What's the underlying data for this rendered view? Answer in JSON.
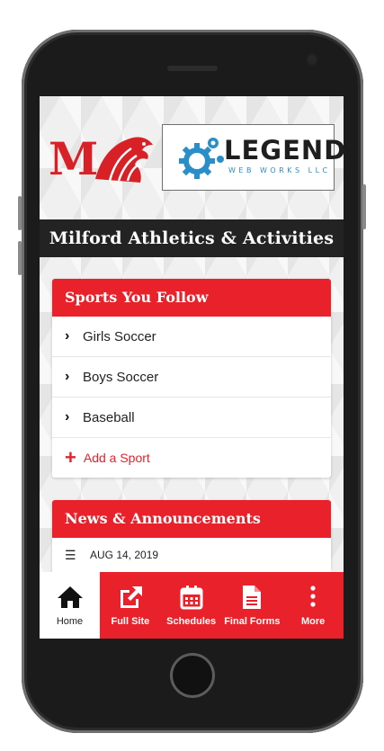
{
  "brand": {
    "school_logo_letter": "M",
    "sponsor_name": "LEGEND",
    "sponsor_tagline": "WEB WORKS LLC"
  },
  "header": {
    "title": "Milford Athletics & Activities"
  },
  "sports_card": {
    "title": "Sports You Follow",
    "items": [
      {
        "label": "Girls Soccer",
        "icon": "chevron-right-icon"
      },
      {
        "label": "Boys Soccer",
        "icon": "chevron-right-icon"
      },
      {
        "label": "Baseball",
        "icon": "chevron-right-icon"
      }
    ],
    "add_label": "Add a Sport"
  },
  "news_card": {
    "title": "News & Announcements",
    "items": [
      {
        "date": "AUG 14, 2019",
        "icon": "menu-icon"
      }
    ]
  },
  "bottom_nav": {
    "items": [
      {
        "label": "Home",
        "icon": "home-icon",
        "active": true
      },
      {
        "label": "Full Site",
        "icon": "external-link-icon",
        "active": false
      },
      {
        "label": "Schedules",
        "icon": "calendar-icon",
        "active": false
      },
      {
        "label": "Final Forms",
        "icon": "document-icon",
        "active": false
      },
      {
        "label": "More",
        "icon": "more-vertical-icon",
        "active": false
      }
    ]
  },
  "colors": {
    "accent": "#e8212a",
    "title_bar": "#232323",
    "sponsor_blue": "#2a8ec8"
  }
}
